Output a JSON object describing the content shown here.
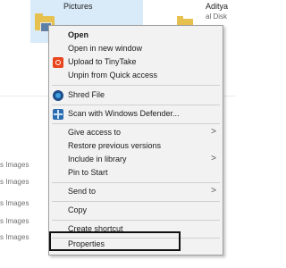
{
  "explorer": {
    "selected_folder_label": "Pictures",
    "drive_label": "Aditya",
    "drive_sub": "al Disk",
    "list_labels": [
      "s Images",
      "s Images",
      "s Images",
      "s Images",
      "s Images"
    ]
  },
  "context_menu": {
    "items": [
      {
        "label": "Open",
        "bold": true,
        "icon": null,
        "submenu": false
      },
      {
        "label": "Open in new window",
        "bold": false,
        "icon": null,
        "submenu": false
      },
      {
        "label": "Upload to TinyTake",
        "bold": false,
        "icon": "tinytake-icon",
        "submenu": false
      },
      {
        "label": "Unpin from Quick access",
        "bold": false,
        "icon": null,
        "submenu": false
      },
      {
        "label": "Shred File",
        "bold": false,
        "icon": "shred-icon",
        "submenu": false
      },
      {
        "label": "Scan with Windows Defender...",
        "bold": false,
        "icon": "defender-icon",
        "submenu": false
      },
      {
        "label": "Give access to",
        "bold": false,
        "icon": null,
        "submenu": true
      },
      {
        "label": "Restore previous versions",
        "bold": false,
        "icon": null,
        "submenu": false
      },
      {
        "label": "Include in library",
        "bold": false,
        "icon": null,
        "submenu": true
      },
      {
        "label": "Pin to Start",
        "bold": false,
        "icon": null,
        "submenu": false
      },
      {
        "label": "Send to",
        "bold": false,
        "icon": null,
        "submenu": true
      },
      {
        "label": "Copy",
        "bold": false,
        "icon": null,
        "submenu": false
      },
      {
        "label": "Create shortcut",
        "bold": false,
        "icon": null,
        "submenu": false
      },
      {
        "label": "Properties",
        "bold": false,
        "icon": null,
        "submenu": false
      }
    ],
    "submenu_arrow": ">"
  },
  "colors": {
    "menu_bg": "#f2f2f2",
    "selection_bg": "#d9ebf9",
    "highlight_border": "#111111"
  }
}
